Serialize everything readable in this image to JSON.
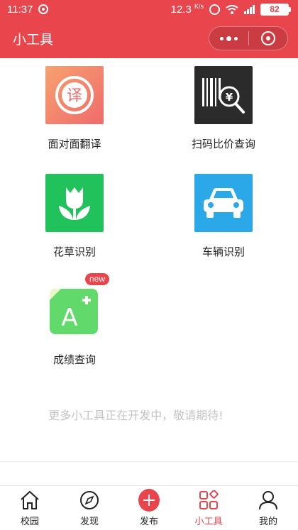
{
  "status_bar": {
    "time": "11:37",
    "speed_value": "12.3",
    "speed_unit": "K/s",
    "network_type": "4G",
    "battery": "82"
  },
  "header": {
    "title": "小工具"
  },
  "tools": [
    {
      "label": "面对面翻译",
      "icon": "translate-icon",
      "glyph": "译"
    },
    {
      "label": "扫码比价查询",
      "icon": "barcode-price-icon",
      "glyph": "¥"
    },
    {
      "label": "花草识别",
      "icon": "tulip-icon"
    },
    {
      "label": "车辆识别",
      "icon": "car-icon"
    },
    {
      "label": "成绩查询",
      "icon": "grade-a-plus-icon",
      "badge": "new",
      "glyph": "A"
    }
  ],
  "dev_note": "更多小工具正在开发中，敬请期待!",
  "tab_bar": {
    "items": [
      {
        "label": "校园",
        "icon": "home-icon",
        "active": false
      },
      {
        "label": "发现",
        "icon": "compass-icon",
        "active": false
      },
      {
        "label": "发布",
        "icon": "plus-icon",
        "active": false
      },
      {
        "label": "小工具",
        "icon": "grid-tools-icon",
        "active": true
      },
      {
        "label": "我的",
        "icon": "user-icon",
        "active": false
      }
    ]
  },
  "colors": {
    "brand_red": "#e8454c",
    "translate_gradient_start": "#f5a16f",
    "translate_gradient_end": "#f06b6b",
    "scan_bg": "#2b2b2b",
    "flower_green": "#21c25b",
    "car_blue": "#2aa8e8",
    "grade_green": "#62d96b"
  }
}
